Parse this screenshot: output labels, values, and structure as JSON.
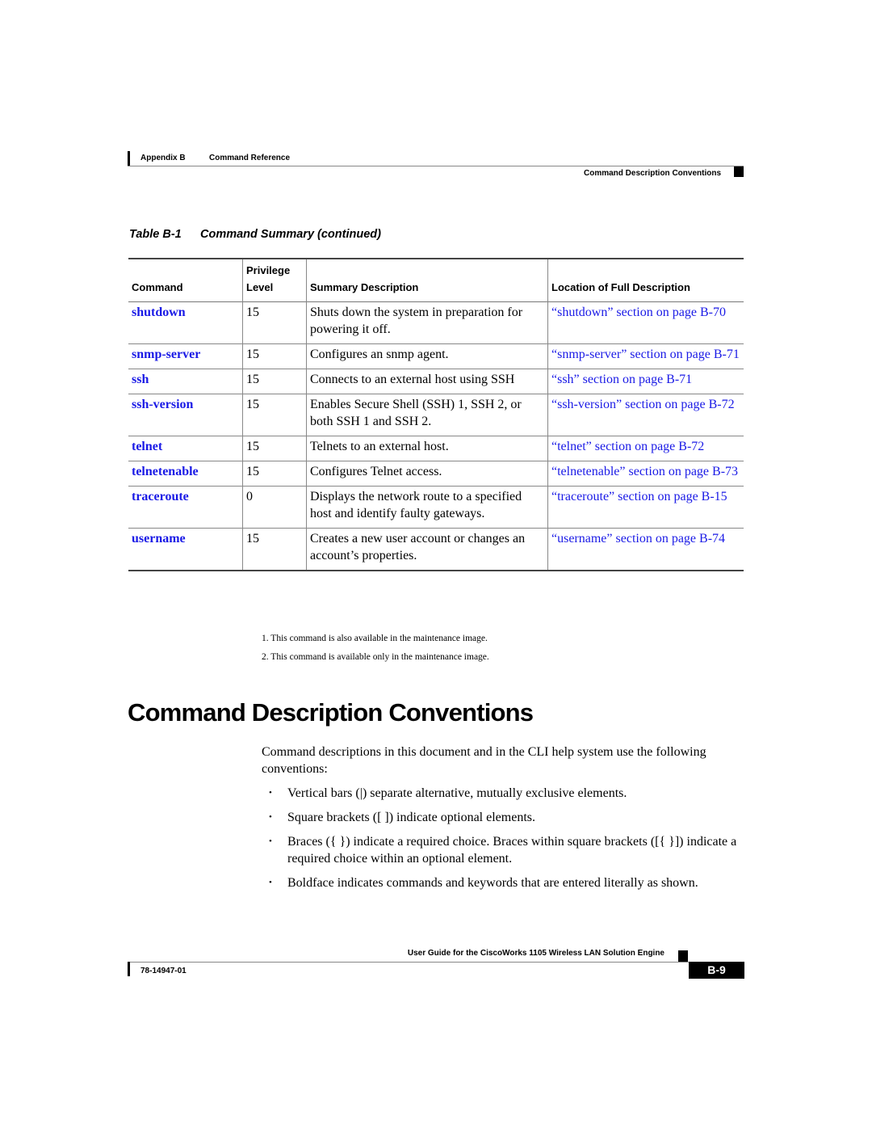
{
  "header": {
    "appendix": "Appendix B",
    "chapter": "Command Reference",
    "section": "Command Description Conventions"
  },
  "table": {
    "caption_number": "Table B-1",
    "caption_title": "Command Summary (continued)",
    "columns": {
      "command": "Command",
      "privilege_line1": "Privilege",
      "privilege_line2": "Level",
      "summary": "Summary Description",
      "location": "Location of Full Description"
    },
    "rows": [
      {
        "command": "shutdown",
        "level": "15",
        "summary": "Shuts down the system in preparation for powering it off.",
        "location": "“shutdown” section on page B-70"
      },
      {
        "command": "snmp-server",
        "level": "15",
        "summary": "Configures an snmp agent.",
        "location": "“snmp-server” section on page B-71"
      },
      {
        "command": "ssh",
        "level": "15",
        "summary": "Connects to an external host using SSH",
        "location": "“ssh” section on page B-71"
      },
      {
        "command": "ssh-version",
        "level": "15",
        "summary": "Enables Secure Shell (SSH) 1, SSH 2, or both SSH 1 and SSH 2.",
        "location": "“ssh-version” section on page B-72"
      },
      {
        "command": "telnet",
        "level": "15",
        "summary": "Telnets to an external host.",
        "location": "“telnet” section on page B-72"
      },
      {
        "command": "telnetenable",
        "level": "15",
        "summary": "Configures Telnet access.",
        "location": "“telnetenable” section on page B-73"
      },
      {
        "command": "traceroute",
        "level": "0",
        "summary": "Displays the network route to a specified host and identify faulty gateways.",
        "location": "“traceroute” section on page B-15"
      },
      {
        "command": "username",
        "level": "15",
        "summary": "Creates a new user account or changes an account’s properties.",
        "location": "“username” section on page B-74"
      }
    ]
  },
  "footnotes": [
    "1. This command is also available in the maintenance image.",
    "2. This command is available only in the maintenance image."
  ],
  "section": {
    "title": "Command Description Conventions",
    "intro": "Command descriptions in this document and in the CLI help system use the following conventions:",
    "bullets": [
      "Vertical bars (|) separate alternative, mutually exclusive elements.",
      "Square brackets ([ ]) indicate optional elements.",
      "Braces ({ }) indicate a required choice. Braces within square brackets ([{ }]) indicate a required choice within an optional element.",
      "Boldface indicates commands and keywords that are entered literally as shown."
    ],
    "bullet_glyph": "•"
  },
  "footer": {
    "guide_title": "User Guide for the CiscoWorks 1105 Wireless LAN Solution Engine",
    "doc_number": "78-14947-01",
    "page_number": "B-9"
  }
}
